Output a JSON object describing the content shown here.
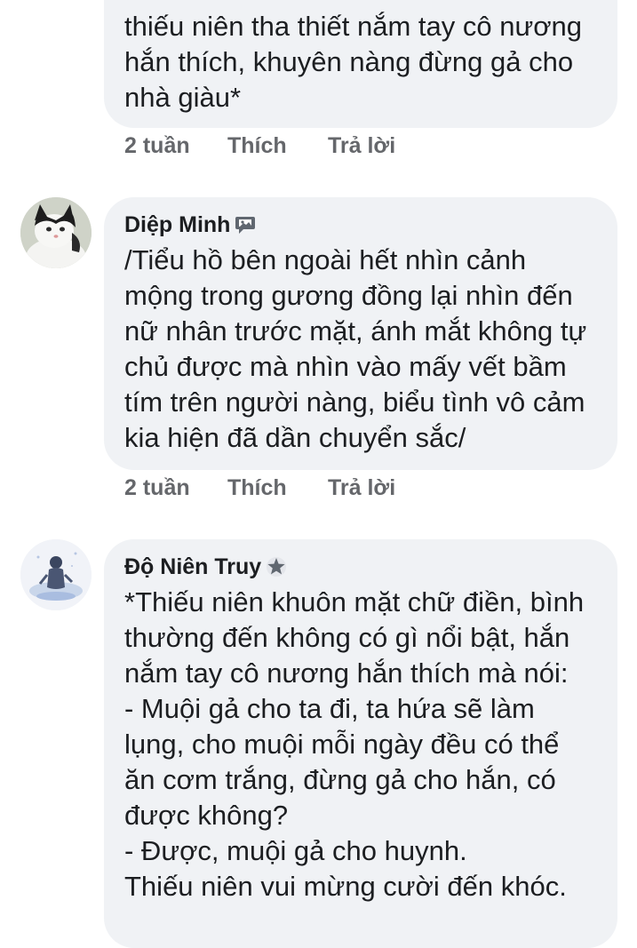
{
  "comments": [
    {
      "author": "",
      "text_lines": [
        "thiếu niên tha thiết nắm tay cô nương",
        "hắn thích, khuyên nàng đừng gả cho",
        "nhà giàu*"
      ],
      "time": "2 tuần",
      "like_label": "Thích",
      "reply_label": "Trả lời"
    },
    {
      "author": "Diệp Minh",
      "badge_icon": "photo-chat-icon",
      "avatar_icon": "cat-avatar",
      "text_lines": [
        "/Tiểu hồ bên ngoài hết nhìn cảnh",
        "mộng trong gương đồng lại nhìn đến",
        "nữ nhân trước mặt, ánh mắt không tự",
        "chủ được mà nhìn vào mấy vết bầm",
        "tím trên người nàng, biểu tình vô cảm",
        "kia hiện đã dần chuyển sắc/"
      ],
      "time": "2 tuần",
      "like_label": "Thích",
      "reply_label": "Trả lời"
    },
    {
      "author": "Độ Niên Truy",
      "badge_icon": "star-badge-icon",
      "avatar_icon": "figure-avatar",
      "text_lines": [
        "*Thiếu niên khuôn mặt chữ điền, bình",
        "thường đến không có gì nổi bật, hắn",
        "nắm tay cô nương hắn thích mà nói:",
        "- Muội gả cho ta đi, ta hứa sẽ làm",
        "lụng, cho muội mỗi ngày đều có thể",
        "ăn cơm trắng, đừng gả cho hắn, có",
        "được không?",
        "- Được, muội gả cho huynh.",
        "Thiếu niên vui mừng cười đến khóc."
      ]
    }
  ],
  "colors": {
    "bubble": "#f0f2f5",
    "text": "#1c1e21",
    "meta": "#65676b"
  }
}
